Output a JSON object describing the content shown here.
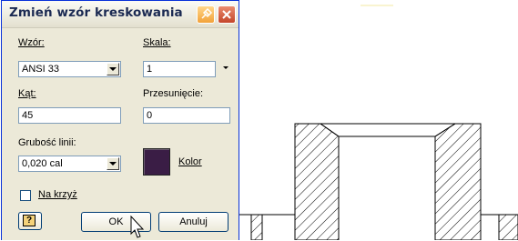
{
  "dialog": {
    "title": "Zmień wzór kreskowania",
    "pattern": {
      "label": "Wzór:",
      "value": "ANSI 33"
    },
    "scale": {
      "label": "Skala:",
      "value": "1"
    },
    "angle": {
      "label": "Kąt:",
      "value": "45"
    },
    "offset": {
      "label": "Przesunięcie:",
      "value": "0"
    },
    "line_weight": {
      "label": "Grubość linii:",
      "value": "0,020 cal"
    },
    "color": {
      "label": "Kolor",
      "swatch": "#3a1d45"
    },
    "cross": {
      "label": "Na krzyż",
      "checked": false
    },
    "buttons": {
      "help": "?",
      "ok": "OK",
      "cancel": "Anuluj"
    }
  },
  "colors": {
    "dialog_bg": "#ECE9D8",
    "title_text": "#1b2a52",
    "window_border": "#0831D9",
    "close_button": "#c4452a"
  }
}
